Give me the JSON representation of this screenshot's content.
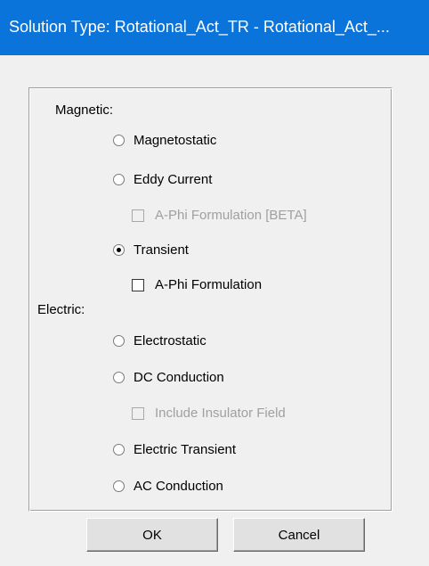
{
  "window": {
    "title": "Solution Type: Rotational_Act_TR - Rotational_Act_..."
  },
  "magnetic": {
    "heading": "Magnetic:",
    "options": [
      {
        "label": "Magnetostatic",
        "selected": false
      },
      {
        "label": "Eddy Current",
        "selected": false
      },
      {
        "label": "Transient",
        "selected": true
      }
    ],
    "eddy_aphi_checkbox": {
      "label": "A-Phi Formulation [BETA]",
      "checked": false,
      "enabled": false
    },
    "transient_aphi_checkbox": {
      "label": "A-Phi Formulation",
      "checked": false,
      "enabled": true
    }
  },
  "electric": {
    "heading": "Electric:",
    "options": [
      {
        "label": "Electrostatic",
        "selected": false
      },
      {
        "label": "DC Conduction",
        "selected": false
      },
      {
        "label": "Electric Transient",
        "selected": false
      },
      {
        "label": "AC Conduction",
        "selected": false
      }
    ],
    "insulator_checkbox": {
      "label": "Include Insulator Field",
      "checked": false,
      "enabled": false
    }
  },
  "buttons": {
    "ok_label": "OK",
    "cancel_label": "Cancel"
  },
  "colors": {
    "titlebar": "#0a74da",
    "dialog_bg": "#f0f0f0",
    "disabled_text": "#a0a0a0"
  }
}
